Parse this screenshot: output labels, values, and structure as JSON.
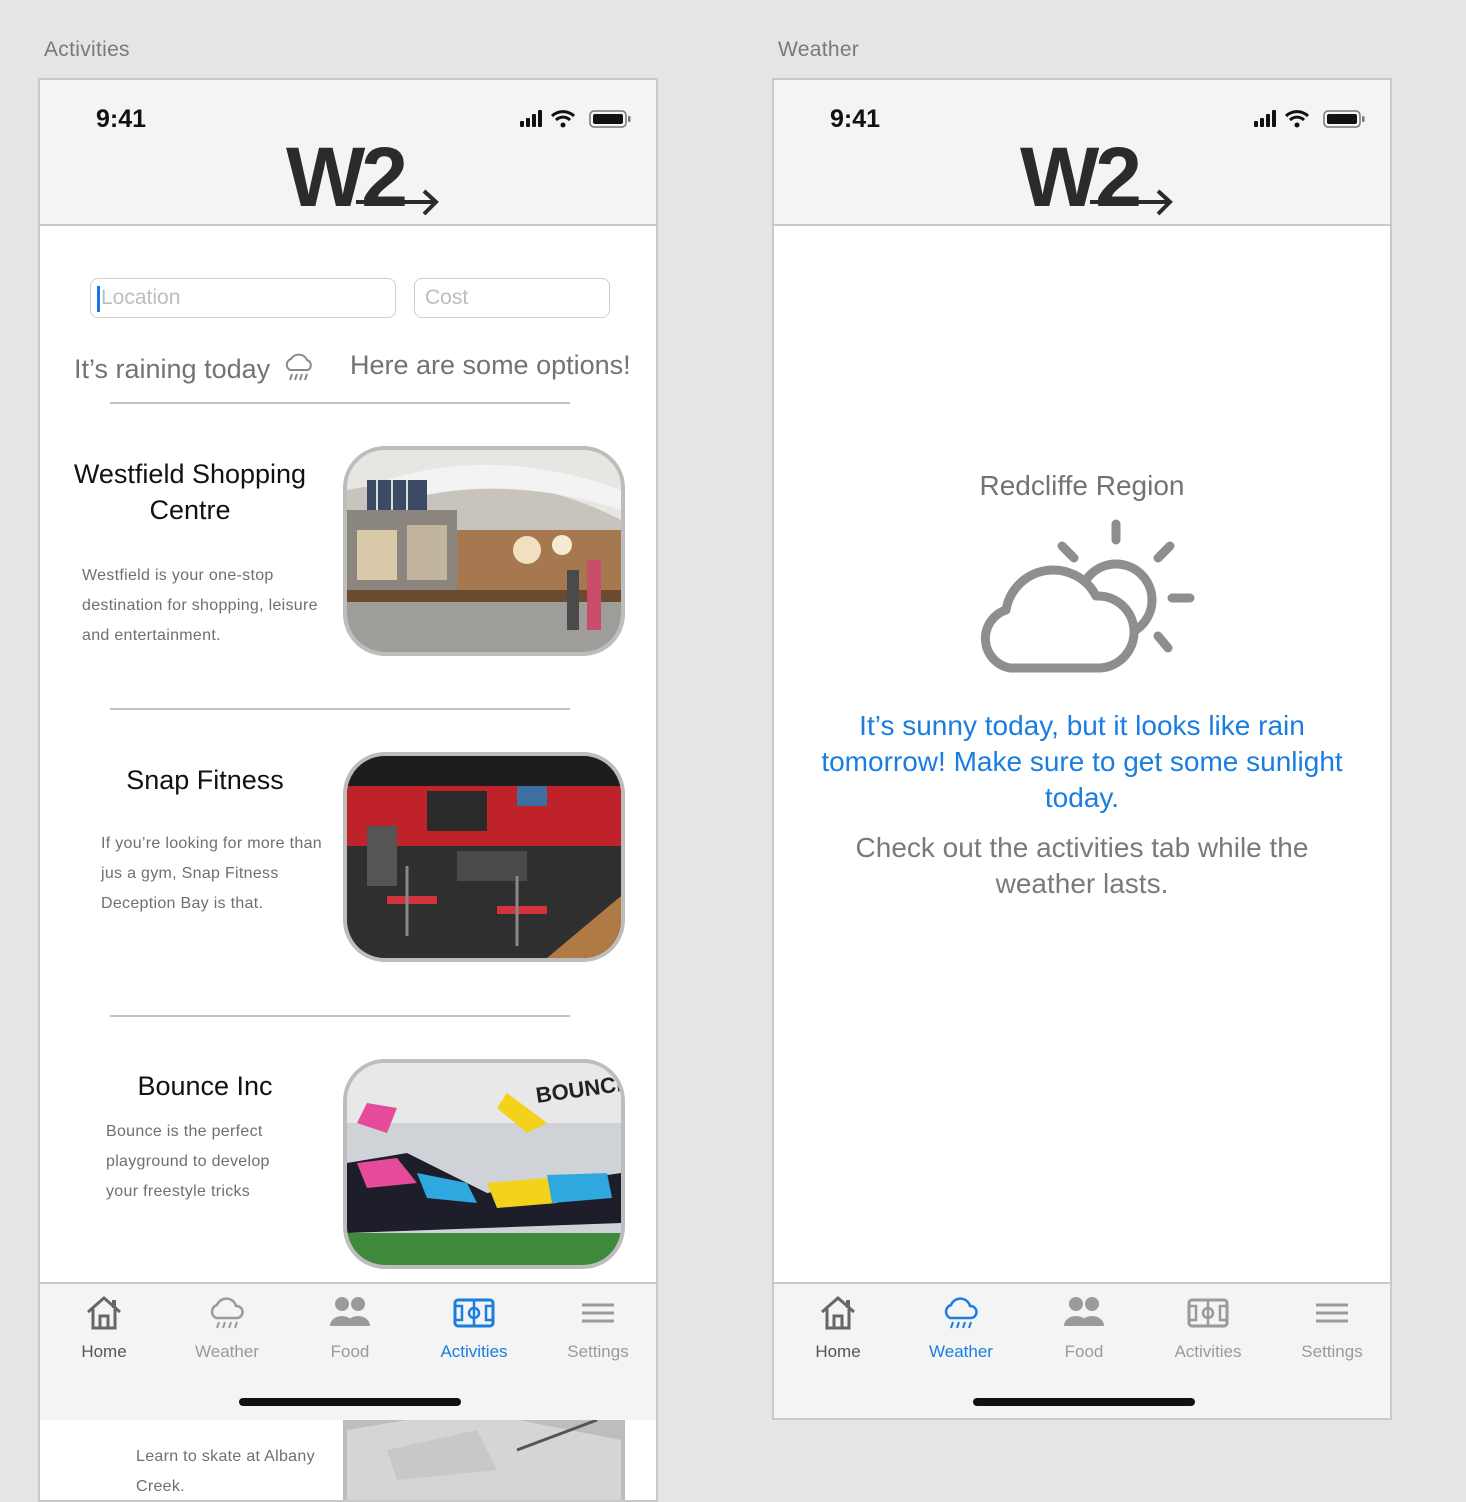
{
  "frames": {
    "activities_title": "Activities",
    "weather_title": "Weather"
  },
  "status_bar": {
    "time": "9:41"
  },
  "app": {
    "logo_text": "W2"
  },
  "activities": {
    "location_placeholder": "Location",
    "cost_placeholder": "Cost",
    "weather_note": "It’s raining today",
    "options_note": "Here are some options!",
    "cards": [
      {
        "title": "Westfield Shopping Centre",
        "description": "Westfield is your one-stop destination for shopping, leisure and entertainment.",
        "photo": "shopping-mall-photo"
      },
      {
        "title": "Snap Fitness",
        "description": "If you’re looking for more than jus a gym, Snap Fitness Deception Bay is that.",
        "photo": "gym-photo"
      },
      {
        "title": "Bounce Inc",
        "description": "Bounce is the perfect playground to develop your freestyle tricks",
        "photo": "trampoline-park-photo",
        "photo_sign": "BOUNCE"
      },
      {
        "title": "",
        "description": "Learn to skate at Albany Creek.",
        "photo": "skate-park-photo"
      }
    ]
  },
  "weather": {
    "region": "Redcliffe Region",
    "icon": "partly-cloudy-icon",
    "sunny_message": "It’s sunny today, but it looks like rain tomorrow! Make sure to get some sunlight today.",
    "activities_message": "Check out the activities tab while the weather lasts."
  },
  "tabs": [
    {
      "label": "Home",
      "icon": "home-icon"
    },
    {
      "label": "Weather",
      "icon": "rain-cloud-icon"
    },
    {
      "label": "Food",
      "icon": "people-icon"
    },
    {
      "label": "Activities",
      "icon": "field-icon"
    },
    {
      "label": "Settings",
      "icon": "menu-lines-icon"
    }
  ],
  "colors": {
    "accent": "#1a7de0",
    "text_gray": "#737373",
    "background": "#e5e5e5",
    "bar": "#f4f4f4"
  }
}
